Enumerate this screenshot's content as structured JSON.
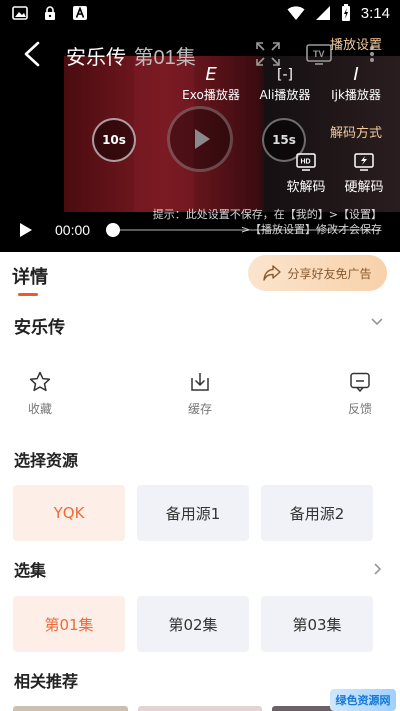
{
  "status_bar": {
    "time": "3:14",
    "icons": [
      "gallery-icon",
      "lock-icon",
      "text-a-icon",
      "wifi-icon",
      "signal-icon",
      "battery-charging-icon"
    ]
  },
  "player": {
    "title": "安乐传",
    "episode_overlay": "第01集",
    "current_time": "00:00",
    "rewind_label": "10s",
    "forward_label": "15s",
    "progress": 0.0,
    "tool_icons": [
      "screen-fit-icon",
      "tv-cast-icon",
      "more-icon"
    ]
  },
  "settings_panel": {
    "title": "播放设置",
    "players": [
      {
        "glyph": "E",
        "label": "Exo播放器"
      },
      {
        "glyph": "[-]",
        "label": "Ali播放器"
      },
      {
        "glyph": "I",
        "label": "Ijk播放器"
      }
    ],
    "decode_title": "解码方式",
    "decoders": [
      {
        "label": "软解码"
      },
      {
        "label": "硬解码"
      }
    ],
    "hint_line1": "提示：此处设置不保存，在【我的】>【设置】",
    "hint_line2": ">【播放设置】修改才会保存"
  },
  "detail": {
    "tab_label": "详情",
    "share_label": "分享好友免广告",
    "show_title": "安乐传",
    "actions": [
      {
        "icon": "star-icon",
        "label": "收藏"
      },
      {
        "icon": "download-icon",
        "label": "缓存"
      },
      {
        "icon": "feedback-icon",
        "label": "反馈"
      }
    ]
  },
  "sources": {
    "title": "选择资源",
    "items": [
      "YQK",
      "备用源1",
      "备用源2"
    ],
    "selected": "YQK"
  },
  "episodes": {
    "title": "选集",
    "items": [
      "第01集",
      "第02集",
      "第03集"
    ],
    "selected": "第01集"
  },
  "related": {
    "title": "相关推荐"
  },
  "watermark": "绿色资源网",
  "colors": {
    "accent": "#ef5a2a",
    "active_tile_bg": "#fdefe8",
    "tile_bg": "#f1f2f7",
    "panel_accent": "#f2c79a"
  }
}
